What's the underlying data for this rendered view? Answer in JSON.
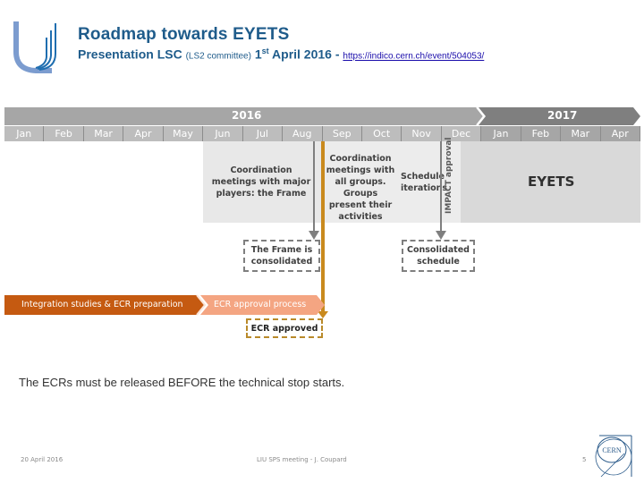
{
  "header": {
    "title": "Roadmap towards EYETS",
    "subtitle_main": "Presentation LSC",
    "subtitle_small": "(LS2 committee)",
    "subtitle_date_num": "1",
    "subtitle_date_sup": "st",
    "subtitle_date_rest": "April 2016 -",
    "link_text": "https://indico.cern.ch/event/504053/"
  },
  "timeline": {
    "years": [
      "2016",
      "2017"
    ],
    "months_2016": [
      "Jan",
      "Feb",
      "Mar",
      "Apr",
      "May",
      "Jun",
      "Jul",
      "Aug",
      "Sep",
      "Oct",
      "Nov",
      "Dec"
    ],
    "months_2017": [
      "Jan",
      "Feb",
      "Mar",
      "Apr"
    ],
    "phases": {
      "frame": "Coordination meetings with major players: the Frame",
      "groups": "Coordination meetings with all groups. Groups present their activities",
      "schedule": "Schedule iterations",
      "impact": "IMPACT approval",
      "eyets": "EYETS"
    },
    "milestones": {
      "frame_consolidated": "The Frame is consolidated",
      "schedule_consolidated": "Consolidated schedule",
      "ecr_approved": "ECR approved"
    },
    "process": {
      "step1": "Integration studies & ECR preparation",
      "step2": "ECR approval process"
    }
  },
  "statement": "The ECRs must be released BEFORE the technical stop starts.",
  "footer": {
    "date": "20 April 2016",
    "event": "LIU SPS meeting - J. Coupard",
    "page": "5",
    "logo_text": "CERN"
  },
  "colors": {
    "title": "#1f5c8b",
    "orange_dark": "#c55a11",
    "orange_light": "#f4a582",
    "orange_line": "#c98a1e",
    "band_2016": "#a6a6a6",
    "band_2017": "#7f7f7f"
  }
}
